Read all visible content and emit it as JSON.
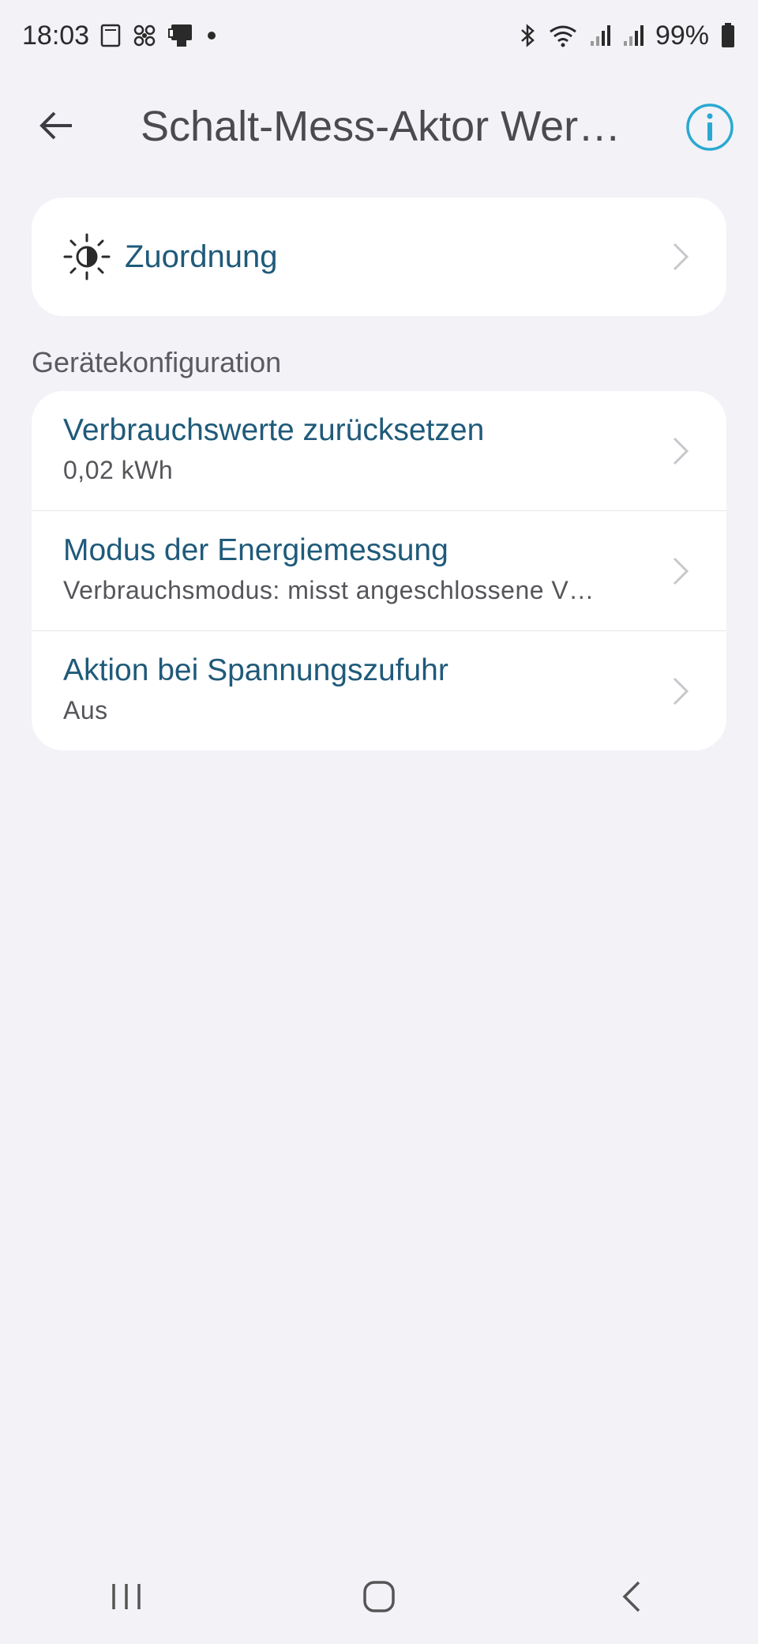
{
  "status_bar": {
    "time": "18:03",
    "battery_percent": "99%",
    "left_icons": [
      "sim-card-icon",
      "fan-icon",
      "device-icon",
      "notification-dot-icon"
    ],
    "right_icons": [
      "bluetooth-icon",
      "wifi-icon",
      "signal-icon",
      "signal-icon",
      "battery-icon"
    ]
  },
  "app_bar": {
    "title": "Schalt-Mess-Aktor Wer…",
    "back_icon": "arrow-left-icon",
    "info_icon": "info-icon",
    "accent_color": "#29a9d1"
  },
  "assignment": {
    "label": "Zuordnung",
    "icon": "brightness-icon"
  },
  "device_config": {
    "section_title": "Gerätekonfiguration",
    "items": [
      {
        "title": "Verbrauchswerte zurücksetzen",
        "subtitle": "0,02 kWh"
      },
      {
        "title": "Modus der Energiemessung",
        "subtitle": "Verbrauchsmodus: misst angeschlossene V…"
      },
      {
        "title": "Aktion bei Spannungszufuhr",
        "subtitle": "Aus"
      }
    ]
  },
  "nav_bar": {
    "buttons": [
      "recent-apps-icon",
      "home-icon",
      "back-icon"
    ]
  },
  "colors": {
    "background": "#f2f2f7",
    "card": "#ffffff",
    "item_title": "#1f5a7a",
    "accent": "#29a9d1"
  }
}
